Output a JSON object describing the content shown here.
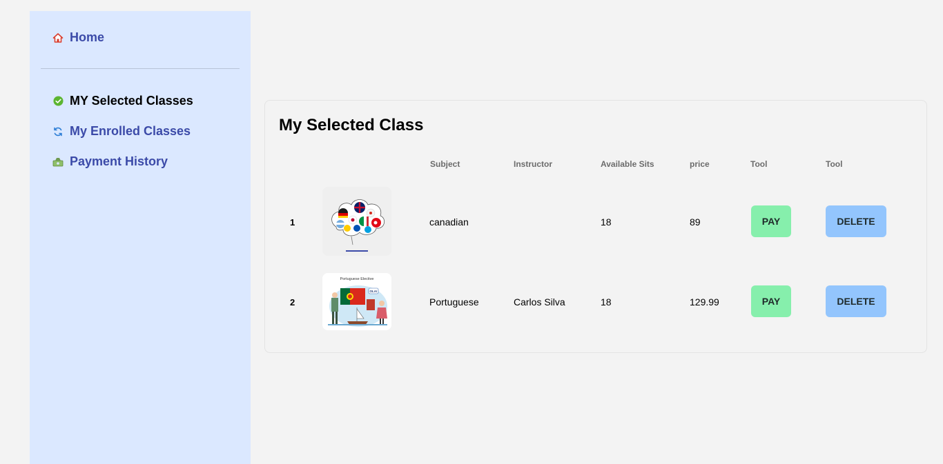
{
  "sidebar": {
    "home": {
      "label": "Home",
      "icon": "home-icon"
    },
    "items": [
      {
        "label": "MY Selected Classes",
        "icon": "check-circle-icon",
        "active": true
      },
      {
        "label": "My Enrolled Classes",
        "icon": "refresh-icon",
        "active": false
      },
      {
        "label": "Payment History",
        "icon": "money-icon",
        "active": false
      }
    ]
  },
  "main": {
    "title": "My Selected Class",
    "columns": [
      "",
      "",
      "Subject",
      "Instructor",
      "Available Sits",
      "price",
      "Tool",
      "Tool"
    ],
    "rows": [
      {
        "num": "1",
        "image": "language-flags-thumbnail",
        "subject": "canadian",
        "instructor": "",
        "seats": "18",
        "price": "89",
        "pay_label": "PAY",
        "delete_label": "DELETE"
      },
      {
        "num": "2",
        "image": "portuguese-elective-thumbnail",
        "image_caption": "Portuguese Elective",
        "image_bubble": "OLA!",
        "subject": "Portuguese",
        "instructor": "Carlos Silva",
        "seats": "18",
        "price": "129.99",
        "pay_label": "PAY",
        "delete_label": "DELETE"
      }
    ]
  },
  "colors": {
    "sidebar_bg": "#dbe8ff",
    "nav_link": "#3b4aa8",
    "pay_button": "#86efac",
    "delete_button": "#93c5fd",
    "page_bg": "#f3f3f3"
  }
}
